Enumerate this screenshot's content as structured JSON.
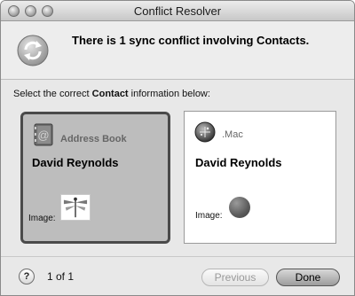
{
  "window": {
    "title": "Conflict Resolver"
  },
  "header": {
    "message": "There is 1 sync conflict involving Contacts."
  },
  "instructions": {
    "prefix": "Select the correct ",
    "keyword": "Contact",
    "suffix": " information below:"
  },
  "options": [
    {
      "source": "Address Book",
      "name": "David Reynolds",
      "image_label": "Image:",
      "selected": true
    },
    {
      "source": ".Mac",
      "name": "David Reynolds",
      "image_label": "Image:",
      "selected": false
    }
  ],
  "footer": {
    "help_label": "?",
    "page_counter": "1 of 1",
    "previous_label": "Previous",
    "done_label": "Done"
  },
  "icons": {
    "sync": "sync-arrows-icon",
    "address_book": "address-book-icon",
    "mac": "dotmac-globe-icon"
  }
}
